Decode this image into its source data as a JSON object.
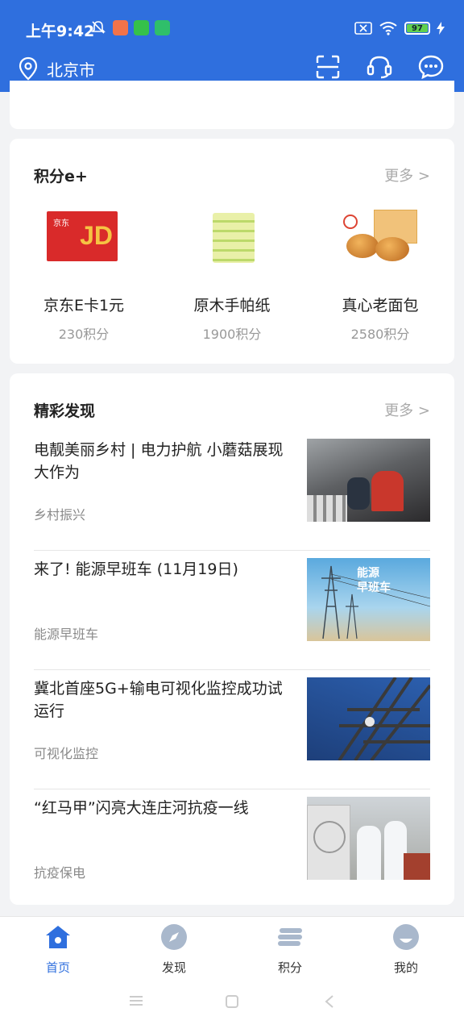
{
  "status_bar": {
    "time": "上午9:42",
    "battery": "97"
  },
  "header": {
    "location": "北京市"
  },
  "points_section": {
    "title": "积分e+",
    "more": "更多 >",
    "items": [
      {
        "name": "京东E卡1元",
        "points": "230积分",
        "logo_text": "JD",
        "brand_text": "京东"
      },
      {
        "name": "原木手帕纸",
        "points": "1900积分"
      },
      {
        "name": "真心老面包",
        "points": "2580积分"
      }
    ]
  },
  "discover_section": {
    "title": "精彩发现",
    "more": "更多 >",
    "news": [
      {
        "title": "电靓美丽乡村 | 电力护航 小蘑菇展现大作为",
        "tag": "乡村振兴"
      },
      {
        "title": "来了! 能源早班车 (11月19日)",
        "tag": "能源早班车",
        "thumb_text": "能源\n早班车"
      },
      {
        "title": "冀北首座5G+输电可视化监控成功试运行",
        "tag": "可视化监控"
      },
      {
        "title": "“红马甲”闪亮大连庄河抗疫一线",
        "tag": "抗疫保电"
      }
    ]
  },
  "tabbar": {
    "tabs": [
      {
        "label": "首页",
        "active": true
      },
      {
        "label": "发现"
      },
      {
        "label": "积分"
      },
      {
        "label": "我的"
      }
    ]
  },
  "colors": {
    "brand": "#2f6fde",
    "background": "#f2f3f5"
  }
}
